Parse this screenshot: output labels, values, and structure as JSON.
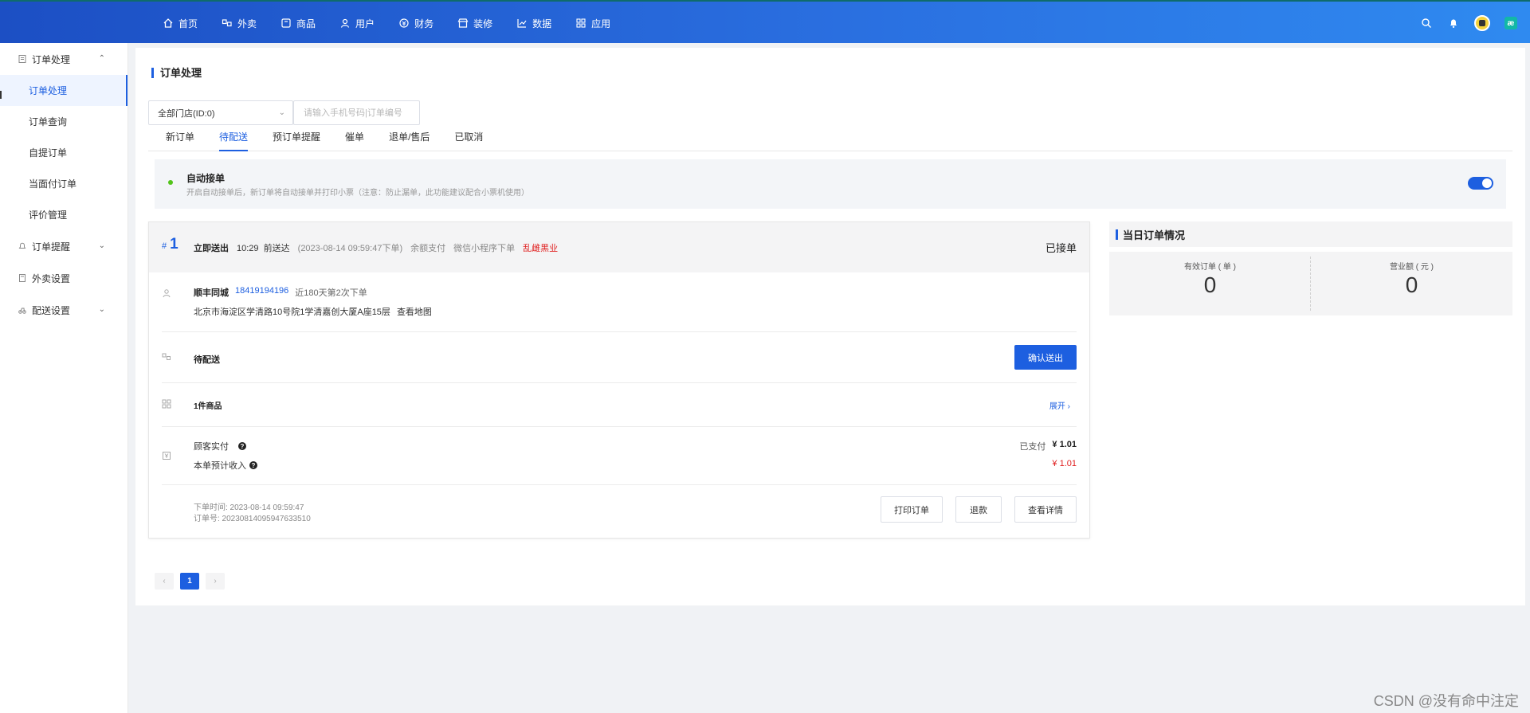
{
  "topnav": {
    "items": [
      {
        "label": "首页",
        "icon": "home-icon"
      },
      {
        "label": "外卖",
        "icon": "delivery-icon"
      },
      {
        "label": "商品",
        "icon": "goods-icon"
      },
      {
        "label": "用户",
        "icon": "user-icon"
      },
      {
        "label": "财务",
        "icon": "finance-icon"
      },
      {
        "label": "装修",
        "icon": "shop-icon"
      },
      {
        "label": "数据",
        "icon": "chart-icon"
      },
      {
        "label": "应用",
        "icon": "apps-icon"
      }
    ],
    "right_icons": [
      "search-icon",
      "bell-icon",
      "avatar",
      "brand-badge-icon"
    ],
    "brand_badge_text": "æ"
  },
  "sidebar": {
    "groups": [
      {
        "label": "订单处理",
        "icon": "order-icon",
        "expanded": true
      },
      {
        "label": "订单提醒",
        "icon": "reminder-icon",
        "expanded": false
      },
      {
        "label": "外卖设置",
        "icon": "settings-doc-icon"
      },
      {
        "label": "配送设置",
        "icon": "delivery-settings-icon",
        "expanded": false
      }
    ],
    "items": [
      {
        "label": "订单处理",
        "active": true
      },
      {
        "label": "订单查询"
      },
      {
        "label": "自提订单"
      },
      {
        "label": "当面付订单"
      },
      {
        "label": "评价管理"
      }
    ]
  },
  "page": {
    "title": "订单处理",
    "store_select": "全部门店(ID:0)",
    "search_placeholder": "请输入手机号码|订单编号",
    "tabs": [
      {
        "label": "新订单"
      },
      {
        "label": "待配送",
        "active": true
      },
      {
        "label": "预订单提醒"
      },
      {
        "label": "催单"
      },
      {
        "label": "退单/售后"
      },
      {
        "label": "已取消"
      }
    ],
    "auto_accept": {
      "title": "自动接单",
      "desc": "开启自动接单后，新订单将自动接单并打印小票（注意：防止漏单，此功能建议配合小票机使用）",
      "enabled": true
    }
  },
  "order": {
    "number": "1",
    "hash": "#",
    "type": "立即送出",
    "time": "10:29",
    "time_suffix": "前送达",
    "placed": "(2023-08-14 09:59:47下单)",
    "payment": "余额支付",
    "channel": "微信小程序下单",
    "tag": "乱雌黑业",
    "status": "已接单",
    "customer": {
      "name": "顺丰同城",
      "phone": "18419194196",
      "history": "近180天第2次下单",
      "address": "北京市海淀区学清路10号院1学清嘉创大厦A座15层",
      "map_link": "查看地图"
    },
    "delivery": {
      "label": "待配送",
      "confirm_button": "确认送出"
    },
    "goods": {
      "label": "1件商品",
      "expand": "展开"
    },
    "payment_detail": {
      "customer_paid_label": "顾客实付",
      "income_label": "本单预计收入",
      "paid_status": "已支付",
      "paid_amount": "¥ 1.01",
      "income_amount": "¥ 1.01"
    },
    "footer": {
      "time": "下单时间: 2023-08-14 09:59:47",
      "order_no": "订单号: 20230814095947633510",
      "print_button": "打印订单",
      "refund_button": "退款",
      "detail_button": "查看详情"
    }
  },
  "stats": {
    "title": "当日订单情况",
    "valid_orders_label": "有效订单 ( 单 )",
    "valid_orders_value": "0",
    "revenue_label": "营业额 ( 元 )",
    "revenue_value": "0"
  },
  "pager": {
    "prev": "‹",
    "current": "1",
    "next": "›"
  },
  "watermark": "CSDN @没有命中注定",
  "colors": {
    "accent": "#1d5fe0",
    "danger": "#e02020",
    "success": "#52c41a"
  }
}
